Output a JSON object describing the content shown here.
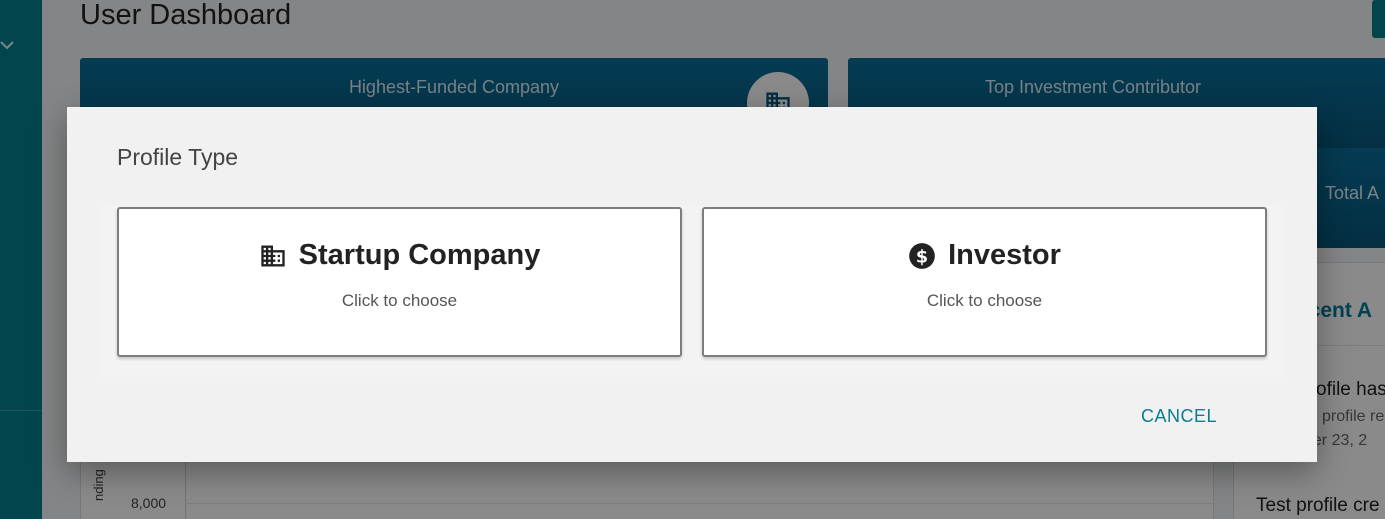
{
  "dashboard": {
    "title": "User Dashboard",
    "cards": {
      "highest_funded_label": "Highest-Funded Company",
      "top_investor_label": "Top Investment Contributor",
      "total_label": "Total A"
    },
    "recent_panel": {
      "title": "ecent A",
      "line1": "ofile has",
      "line2": "profile re",
      "line3": "ber 23, 2",
      "line4": "Test profile cre"
    },
    "chart": {
      "tick_label": "8,000",
      "y_label": "nding"
    }
  },
  "dialog": {
    "title": "Profile Type",
    "options": [
      {
        "label": "Startup Company",
        "subtitle": "Click to choose",
        "icon": "building-icon"
      },
      {
        "label": "Investor",
        "subtitle": "Click to choose",
        "icon": "dollar-circle-icon"
      }
    ],
    "cancel_label": "CANCEL"
  },
  "colors": {
    "accent": "#0a7d8f",
    "sidebar": "#03808f",
    "card_blue": "#07577a",
    "backdrop": "rgba(0,0,0,0.46)"
  }
}
